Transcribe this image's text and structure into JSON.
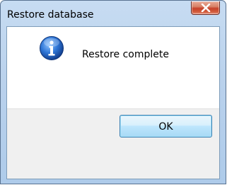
{
  "window": {
    "title": "Restore database",
    "close_icon": "close-x-icon"
  },
  "dialog": {
    "icon": "info-icon",
    "message": "Restore complete",
    "ok_label": "OK"
  },
  "colors": {
    "titlebar": "#b9d1ec",
    "close_button": "#c7412a",
    "footer": "#f0f0f0",
    "ok_border": "#3c7fb1",
    "info_icon": "#1f5fbf"
  }
}
